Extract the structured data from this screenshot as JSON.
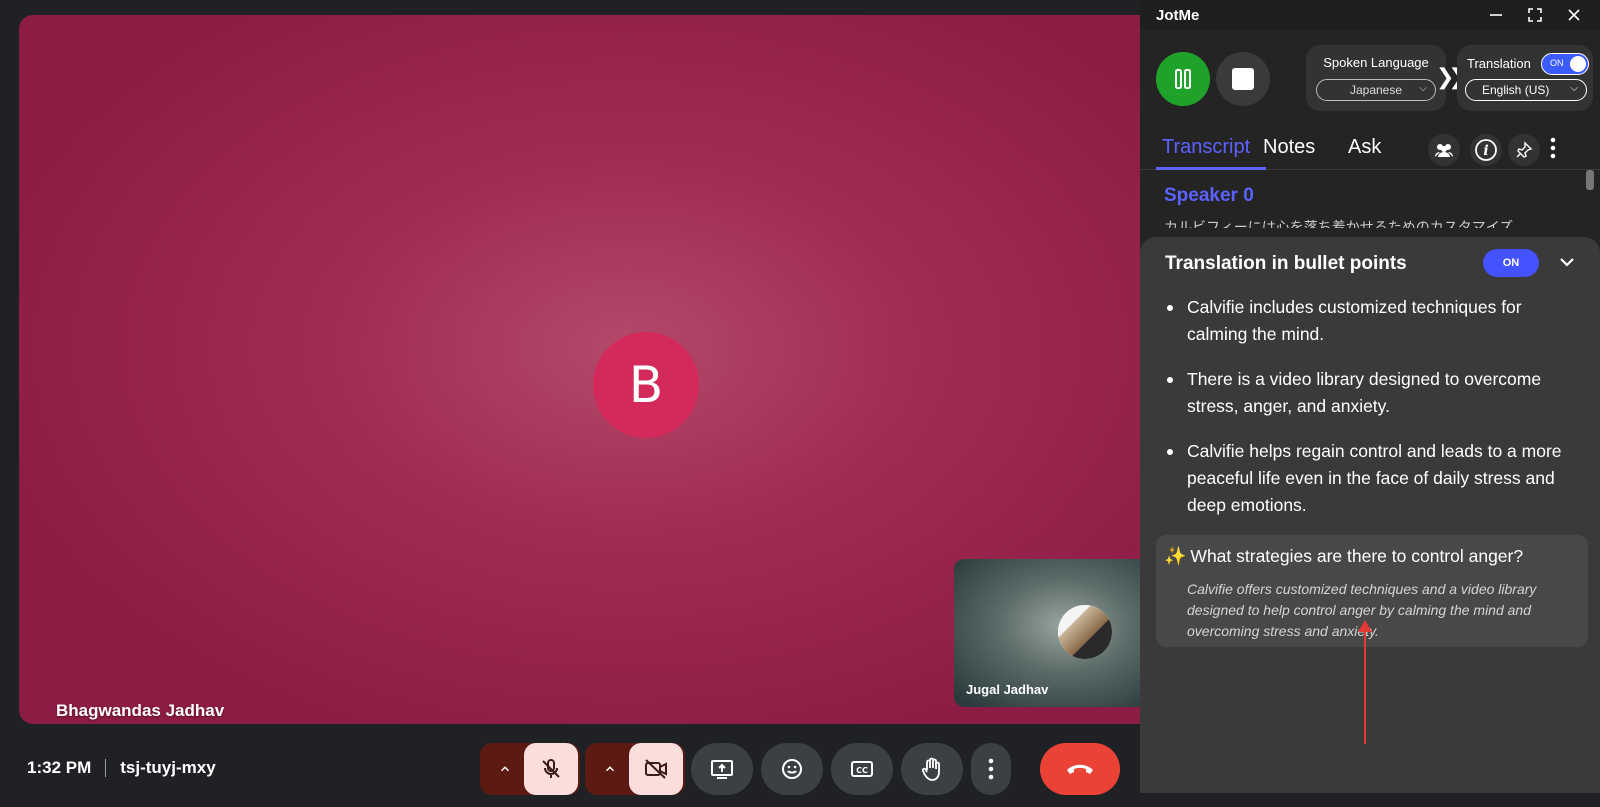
{
  "meeting": {
    "main_participant": {
      "initial": "B",
      "name": "Bhagwandas Jadhav"
    },
    "self_participant": {
      "name": "Jugal Jadhav"
    },
    "time": "1:32 PM",
    "meeting_code": "tsj-tuyj-mxy"
  },
  "controls": {
    "mic": "mic-off",
    "camera": "camera-off",
    "present": "present",
    "emoji": "emoji",
    "captions": "CC",
    "hand": "raise-hand",
    "more": "more",
    "end_call": "end-call"
  },
  "jotme": {
    "app_title": "JotMe",
    "spoken_language_label": "Spoken Language",
    "spoken_language_value": "Japanese",
    "translation_label": "Translation",
    "translation_toggle": "ON",
    "translation_value": "English (US)",
    "tabs": [
      {
        "label": "Transcript",
        "active": true
      },
      {
        "label": "Notes",
        "active": false
      },
      {
        "label": "Ask",
        "active": false
      }
    ],
    "transcript": {
      "speaker": "Speaker 0",
      "text": "カルビフィーには心を落ち着かせるためのカスタマイズ"
    },
    "bullet_sheet": {
      "title": "Translation in bullet points",
      "toggle": "ON",
      "bullets": [
        "Calvifie includes customized techniques for calming the mind.",
        "There is a video library designed to overcome stress, anger, and anxiety.",
        "Calvifie helps regain control and leads to a more peaceful life even in the face of daily stress and deep emotions."
      ],
      "qa": {
        "question": "What strategies are there to control anger?",
        "answer": "Calvifie offers customized techniques and a video library designed to help control anger by calming the mind and overcoming stress and anxiety."
      }
    },
    "colors": {
      "accent": "#5b62ff",
      "record": "#1fa22a",
      "end_call": "#ea4335",
      "annotation": "#e53935"
    }
  }
}
